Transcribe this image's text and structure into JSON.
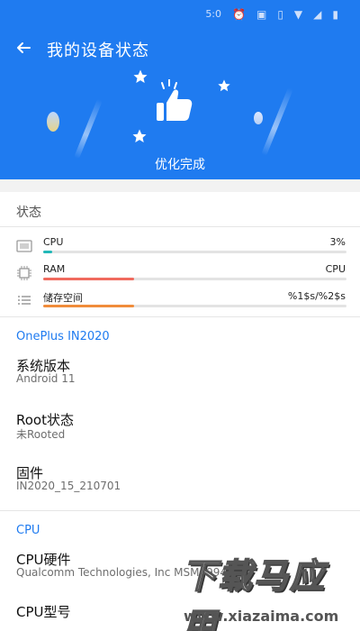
{
  "status_bar": {
    "time": "5:0",
    "icons": [
      "alarm-icon",
      "nfc-icon",
      "vibrate-icon",
      "wifi-icon",
      "signal-icon",
      "battery-icon"
    ]
  },
  "header": {
    "title": "我的设备状态",
    "subtitle": "优化完成",
    "colors": {
      "background": "#1f7bf0",
      "text": "#ffffff"
    }
  },
  "status_section": {
    "title": "状态",
    "metrics": [
      {
        "label": "CPU",
        "value": "3%",
        "icon": "display-icon",
        "fill_fraction": 0.03,
        "color": "#22b8b8"
      },
      {
        "label": "RAM",
        "value": "CPU",
        "icon": "chip-icon",
        "fill_fraction": 0.3,
        "color": "#f06a5e"
      },
      {
        "label": "储存空间",
        "value": "%1$s/%2$s",
        "icon": "list-icon",
        "fill_fraction": 0.3,
        "color": "#f08c3a"
      }
    ]
  },
  "device_section": {
    "title": "OnePlus IN2020",
    "items": [
      {
        "title": "系统版本",
        "value": "Android 11"
      },
      {
        "title": "Root状态",
        "value": "未Rooted"
      },
      {
        "title": "固件",
        "value": "IN2020_15_210701"
      }
    ]
  },
  "cpu_section": {
    "title": "CPU",
    "items": [
      {
        "title": "CPU硬件",
        "value": "Qualcomm Technologies, Inc MSM8994"
      },
      {
        "title": "CPU型号",
        "value": ""
      }
    ]
  },
  "watermark": {
    "main": "下载马应用",
    "url": "www.xiazaima.com"
  }
}
